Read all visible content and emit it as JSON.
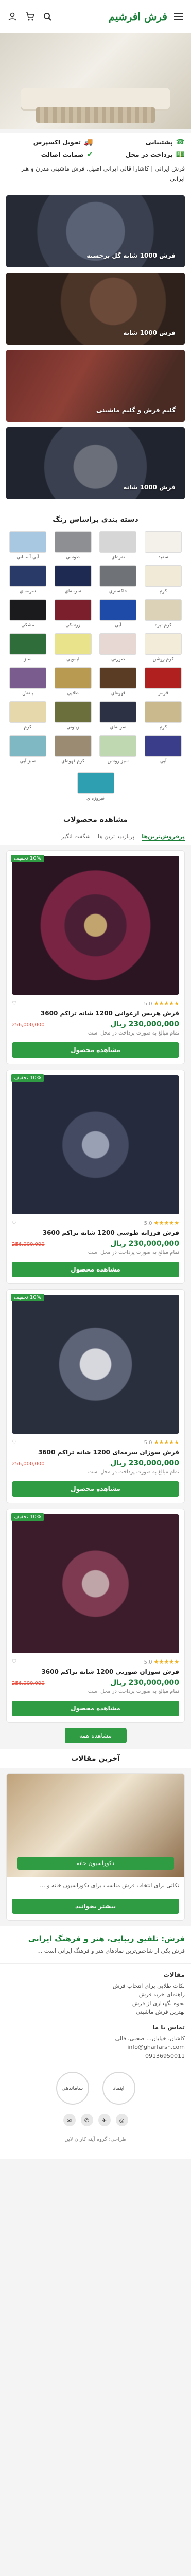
{
  "header": {
    "logo_text": "فرش افرشیم",
    "cart_count": "0"
  },
  "features": [
    "پشتیبانی",
    "تحویل اکسپرس",
    "پرداخت در محل",
    "ضمانت اصالت"
  ],
  "intro_text": "فرش ایرانی | کاشارا قالی ایرانی اصیل، فرش ماشینی مدرن و هنر ایرانی",
  "category_banners": [
    "فرش 1000 شانه گل برجسته",
    "فرش 1000 شانه",
    "گلیم فرش و گلیم ماشینی",
    "فرش 1000 شانه"
  ],
  "color_section_title": "دسته بندی براساس رنگ",
  "color_swatches": [
    {
      "name": "سفید",
      "color": "#f4f1ea"
    },
    {
      "name": "نقره‌ای",
      "color": "#d6d6d6"
    },
    {
      "name": "طوسی",
      "color": "#8d8f93"
    },
    {
      "name": "آبی آسمانی",
      "color": "#a8c8e2"
    },
    {
      "name": "کرم",
      "color": "#f0ead7"
    },
    {
      "name": "خاکستری",
      "color": "#6f7277"
    },
    {
      "name": "سرمه‌ای",
      "color": "#1e2a52"
    },
    {
      "name": "سرمه‌ای",
      "color": "#2a3a68"
    },
    {
      "name": "کرم تیره",
      "color": "#dcd2b7"
    },
    {
      "name": "آبی",
      "color": "#1e4aa8"
    },
    {
      "name": "زرشکی",
      "color": "#7a1f2b"
    },
    {
      "name": "مشکی",
      "color": "#1b1b1d"
    },
    {
      "name": "کرم روشن",
      "color": "#f3ecd8"
    },
    {
      "name": "صورتی",
      "color": "#e8d8d4"
    },
    {
      "name": "لیمویی",
      "color": "#e9e38c"
    },
    {
      "name": "سبز",
      "color": "#2f6d3a"
    },
    {
      "name": "قرمز",
      "color": "#b0201e"
    },
    {
      "name": "قهوه‌ای",
      "color": "#5a3b24"
    },
    {
      "name": "طلایی",
      "color": "#b99a51"
    },
    {
      "name": "بنفش",
      "color": "#7a5c8e"
    },
    {
      "name": "کرم",
      "color": "#c9b98c"
    },
    {
      "name": "سرمه‌ای",
      "color": "#2d3144"
    },
    {
      "name": "زیتونی",
      "color": "#6b6f3c"
    },
    {
      "name": "کرم",
      "color": "#e7d8ab"
    },
    {
      "name": "آبی",
      "color": "#3a3d8a"
    },
    {
      "name": "سبز روشن",
      "color": "#bfd8b2"
    },
    {
      "name": "کرم قهوه‌ای",
      "color": "#9c8b73"
    },
    {
      "name": "سبز آبی",
      "color": "#7fb8c2"
    }
  ],
  "color_last": {
    "name": "فیروزه‌ای",
    "color": "#2e9fb0"
  },
  "products_section_title": "مشاهده محصولات",
  "filter_chips": [
    "پرفروش‌ترین‌ها",
    "پربازدید ترین ها",
    "شگفت انگیز"
  ],
  "products": [
    {
      "badge": "10% تخفیف",
      "rating": "5.0",
      "stars": "★★★★★",
      "name": "فرش هریس ارغوانی 1200 شانه تراکم 3600",
      "old_price": "256,000,000",
      "price": "230,000,000 ریال",
      "note": "تمام مبالغ به صورت پرداخت در محل است",
      "button": "مشاهده محصول"
    },
    {
      "badge": "10% تخفیف",
      "rating": "5.0",
      "stars": "★★★★★",
      "name": "فرش فرزانه طوسی 1200 شانه تراکم 3600",
      "old_price": "256,000,000",
      "price": "230,000,000 ریال",
      "note": "تمام مبالغ به صورت پرداخت در محل است",
      "button": "مشاهده محصول"
    },
    {
      "badge": "10% تخفیف",
      "rating": "5.0",
      "stars": "★★★★★",
      "name": "فرش سوزان سرمه‌ای 1200 شانه تراکم 3600",
      "old_price": "256,000,000",
      "price": "230,000,000 ریال",
      "note": "تمام مبالغ به صورت پرداخت در محل است",
      "button": "مشاهده محصول"
    },
    {
      "badge": "10% تخفیف",
      "rating": "5.0",
      "stars": "★★★★★",
      "name": "فرش سوزان صورتی 1200 شانه تراکم 3600",
      "old_price": "256,000,000",
      "price": "230,000,000 ریال",
      "note": "تمام مبالغ به صورت پرداخت در محل است",
      "button": "مشاهده محصول"
    }
  ],
  "show_all": "مشاهده همه",
  "articles_title": "آخرین مقالات",
  "article": {
    "title": "دکوراسیون خانه",
    "desc": "نکاتی برای انتخاب فرش مناسب برای دکوراسیون خانه و ...",
    "button": "بیشتر بخوانید"
  },
  "tagline": {
    "heading": "فرش: تلفیق زیبایی، هنر و فرهنگ ایرانی",
    "text": "فرش یکی از شاخص‌ترین نمادهای هنر و فرهنگ ایرانی است ..."
  },
  "footer": {
    "links_title": "مقالات",
    "links": [
      "نکات طلایی برای انتخاب فرش",
      "راهنمای خرید فرش",
      "نحوه نگهداری از فرش",
      "بهترین فرش ماشینی"
    ],
    "contact_title": "تماس با ما",
    "address": "کاشان، خیابان... صحنی، قالی",
    "email": "info@gharfarsh.com",
    "phone": "09136950011",
    "trust_1": "اینماد",
    "trust_2": "ساماندهی",
    "copyright": "طراحی: گروه آینه کاران لاین"
  }
}
